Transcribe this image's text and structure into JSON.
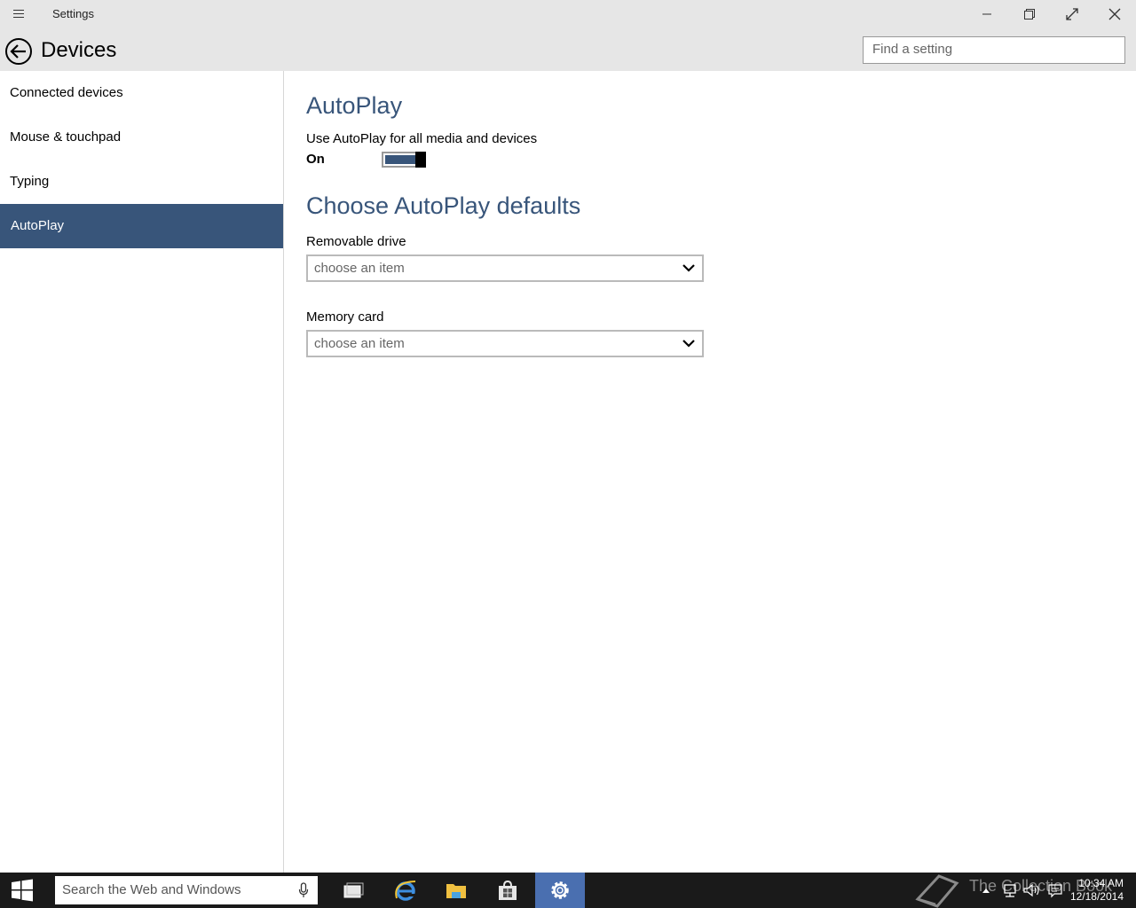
{
  "window": {
    "title": "Settings"
  },
  "header": {
    "page_title": "Devices",
    "search_placeholder": "Find a setting"
  },
  "sidebar": {
    "items": [
      {
        "label": "Connected devices"
      },
      {
        "label": "Mouse & touchpad"
      },
      {
        "label": "Typing"
      },
      {
        "label": "AutoPlay",
        "active": true
      }
    ]
  },
  "main": {
    "section1_title": "AutoPlay",
    "toggle_label": "Use AutoPlay for all media and devices",
    "toggle_state": "On",
    "section2_title": "Choose AutoPlay defaults",
    "dropdowns": [
      {
        "label": "Removable drive",
        "value": "choose an item"
      },
      {
        "label": "Memory card",
        "value": "choose an item"
      }
    ]
  },
  "taskbar": {
    "search_placeholder": "Search the Web and Windows",
    "watermark": "The Collection Book",
    "time": "10:34 AM",
    "date": "12/18/2014"
  },
  "colors": {
    "accent": "#38557a",
    "taskbar": "#1a1a1a",
    "chrome": "#e6e6e6"
  }
}
